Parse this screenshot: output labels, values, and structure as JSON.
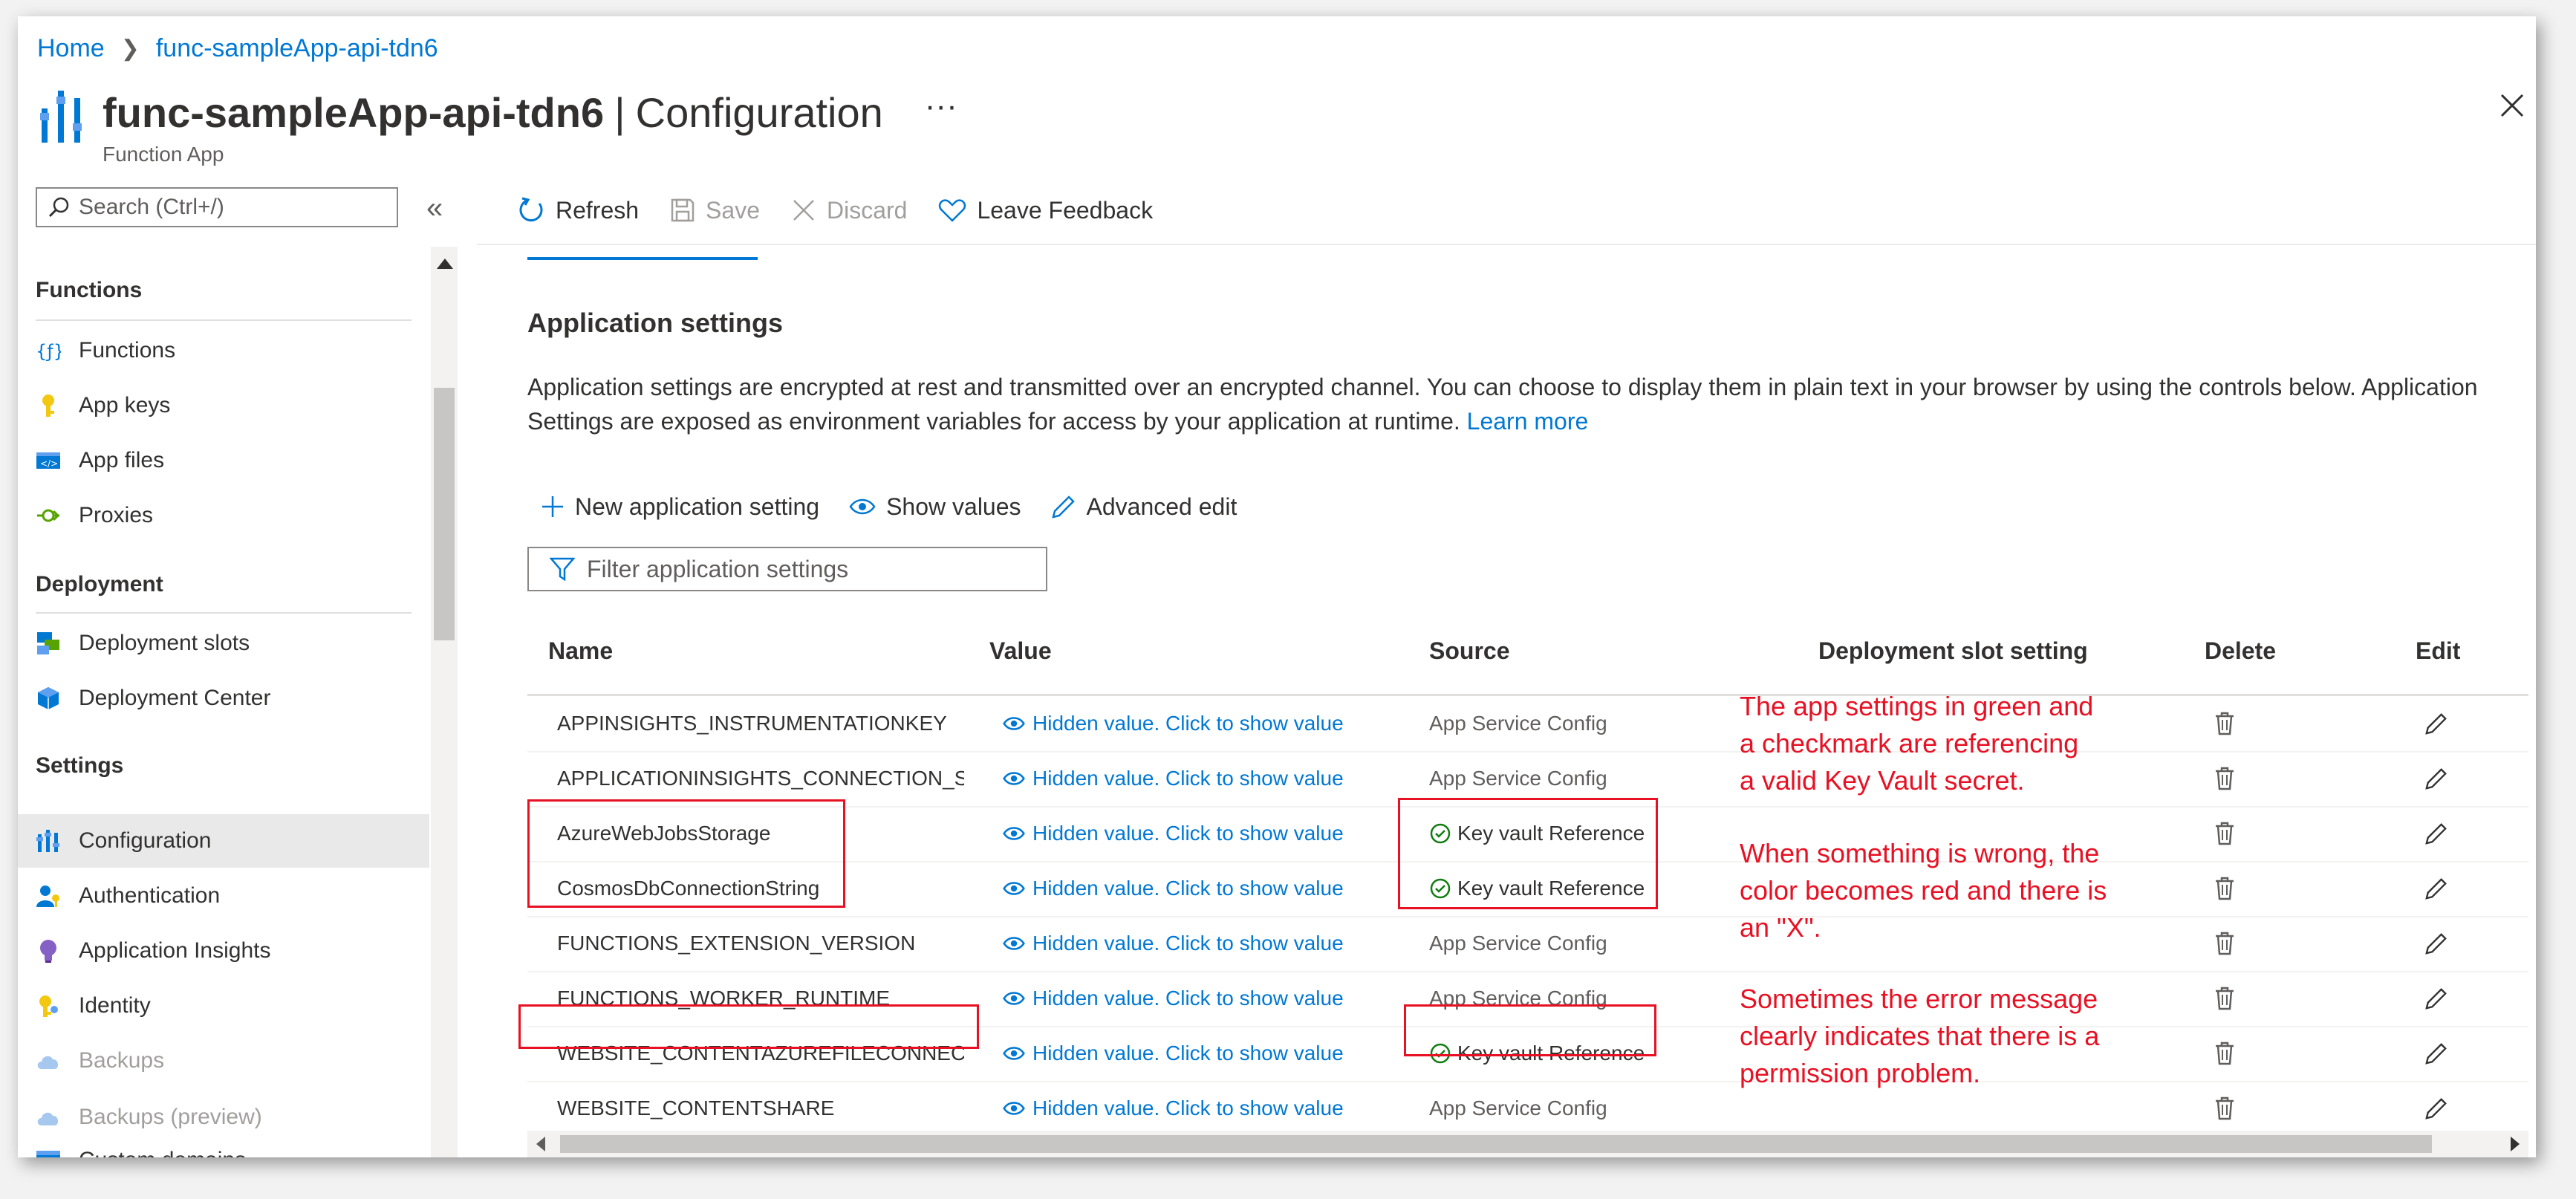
{
  "breadcrumb": {
    "home": "Home",
    "separator": ">",
    "resource": "func-sampleApp-api-tdn6"
  },
  "header": {
    "resource_name": "func-sampleApp-api-tdn6",
    "separator": "|",
    "page": "Configuration",
    "more": "···",
    "subtitle": "Function App"
  },
  "sidebar": {
    "search_placeholder": "Search (Ctrl+/)",
    "collapse": "«",
    "sections": {
      "functions": "Functions",
      "deployment": "Deployment",
      "settings": "Settings"
    },
    "items": [
      {
        "label": "Functions",
        "icon": "function-icon"
      },
      {
        "label": "App keys",
        "icon": "key-icon"
      },
      {
        "label": "App files",
        "icon": "code-file-icon"
      },
      {
        "label": "Proxies",
        "icon": "proxy-icon"
      },
      {
        "label": "Deployment slots",
        "icon": "slots-icon"
      },
      {
        "label": "Deployment Center",
        "icon": "cube-icon"
      },
      {
        "label": "Configuration",
        "icon": "config-bars-icon",
        "selected": true
      },
      {
        "label": "Authentication",
        "icon": "person-key-icon"
      },
      {
        "label": "Application Insights",
        "icon": "lightbulb-icon"
      },
      {
        "label": "Identity",
        "icon": "identity-key-icon"
      },
      {
        "label": "Backups",
        "icon": "cloud-icon",
        "disabled": true
      },
      {
        "label": "Backups (preview)",
        "icon": "cloud-icon",
        "disabled": true
      },
      {
        "label": "Custom domains",
        "icon": "domain-icon"
      }
    ]
  },
  "toolbar": {
    "refresh": "Refresh",
    "save": "Save",
    "discard": "Discard",
    "feedback": "Leave Feedback"
  },
  "content": {
    "title": "Application settings",
    "description": "Application settings are encrypted at rest and transmitted over an encrypted channel. You can choose to display them in plain text in your browser by using the controls below. Application Settings are exposed as environment variables for access by your application at runtime.",
    "learn_more": "Learn more",
    "new_setting": "New application setting",
    "show_values": "Show values",
    "advanced_edit": "Advanced edit",
    "filter_placeholder": "Filter application settings"
  },
  "table": {
    "columns": [
      "Name",
      "Value",
      "Source",
      "Deployment slot setting",
      "Delete",
      "Edit"
    ],
    "rows": [
      {
        "name": "APPINSIGHTS_INSTRUMENTATIONKEY",
        "value": "Hidden value. Click to show value",
        "source": "App Service Config",
        "kv": false
      },
      {
        "name": "APPLICATIONINSIGHTS_CONNECTION_STRIN",
        "value": "Hidden value. Click to show value",
        "source": "App Service Config",
        "kv": false
      },
      {
        "name": "AzureWebJobsStorage",
        "value": "Hidden value. Click to show value",
        "source": "Key vault Reference",
        "kv": true
      },
      {
        "name": "CosmosDbConnectionString",
        "value": "Hidden value. Click to show value",
        "source": "Key vault Reference",
        "kv": true
      },
      {
        "name": "FUNCTIONS_EXTENSION_VERSION",
        "value": "Hidden value. Click to show value",
        "source": "App Service Config",
        "kv": false
      },
      {
        "name": "FUNCTIONS_WORKER_RUNTIME",
        "value": "Hidden value. Click to show value",
        "source": "App Service Config",
        "kv": false
      },
      {
        "name": "WEBSITE_CONTENTAZUREFILECONNECTIONS",
        "value": "Hidden value. Click to show value",
        "source": "Key vault Reference",
        "kv": true
      },
      {
        "name": "WEBSITE_CONTENTSHARE",
        "value": "Hidden value. Click to show value",
        "source": "App Service Config",
        "kv": false
      }
    ]
  },
  "annotations": {
    "note1": "The app settings in green and\na checkmark are referencing\na valid Key Vault secret.",
    "note2": "When something is wrong, the\ncolor becomes red and there is\nan \"X\".",
    "note3": "Sometimes the error message\nclearly indicates that there is a\npermission problem."
  },
  "colors": {
    "accent": "#0078d4",
    "annotation_red": "#e81123",
    "kv_green": "#107c10"
  }
}
